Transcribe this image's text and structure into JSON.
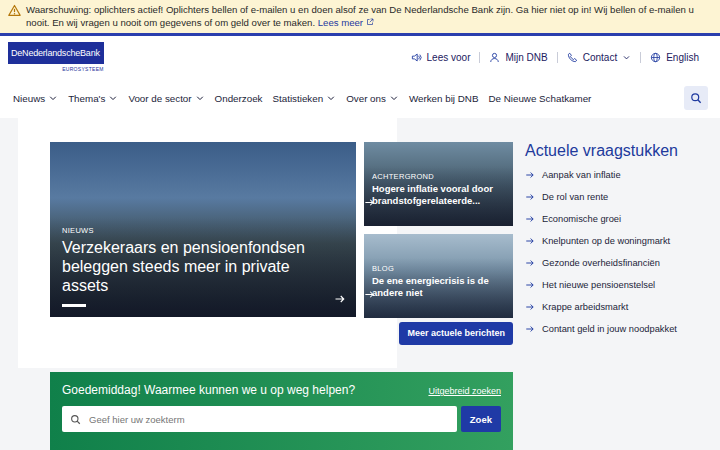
{
  "banner": {
    "text": "Waarschuwing: oplichters actief! Oplichters bellen of e-mailen u en doen alsof ze van De Nederlandsche Bank zijn. Ga hier niet op in! Wij bellen of e-mailen u nooit. En wij vragen u nooit om gegevens of om geld over te maken.",
    "link": "Lees meer"
  },
  "logo": {
    "name": "DeNederlandscheBank",
    "subtitle": "EUROSYSTEEM"
  },
  "utility_links": [
    {
      "label": "Lees voor",
      "dropdown": false
    },
    {
      "label": "Mijn DNB",
      "dropdown": false
    },
    {
      "label": "Contact",
      "dropdown": true
    },
    {
      "label": "English",
      "dropdown": false
    }
  ],
  "nav": [
    {
      "label": "Nieuws",
      "dropdown": true
    },
    {
      "label": "Thema's",
      "dropdown": true
    },
    {
      "label": "Voor de sector",
      "dropdown": true
    },
    {
      "label": "Onderzoek",
      "dropdown": false
    },
    {
      "label": "Statistieken",
      "dropdown": true
    },
    {
      "label": "Over ons",
      "dropdown": true
    },
    {
      "label": "Werken bij DNB",
      "dropdown": false
    },
    {
      "label": "De Nieuwe Schatkamer",
      "dropdown": false
    }
  ],
  "hero": {
    "tag": "NIEUWS",
    "title": "Verzekeraars en pensioenfondsen beleggen steeds meer in private assets",
    "slides": [
      {
        "selected": true
      }
    ]
  },
  "cards": [
    {
      "tag": "ACHTERGROND",
      "title": "Hogere inflatie vooral door brandstofgerelateerde..."
    },
    {
      "tag": "BLOG",
      "title": "De ene energiecrisis is de andere niet"
    }
  ],
  "more_button": "Meer actuele berichten",
  "topics": {
    "title": "Actuele vraagstukken",
    "items": [
      "Aanpak van inflatie",
      "De rol van rente",
      "Economische groei",
      "Knelpunten op de woningmarkt",
      "Gezonde overheidsfinanciën",
      "Het nieuwe pensioenstelsel",
      "Krappe arbeidsmarkt",
      "Contant geld in jouw noodpakket"
    ]
  },
  "search": {
    "greeting": "Goedemiddag! Waarmee kunnen we u op weg helpen?",
    "advanced": "Uitgebreid zoeken",
    "placeholder": "Geef hier uw zoekterm",
    "button": "Zoek"
  }
}
